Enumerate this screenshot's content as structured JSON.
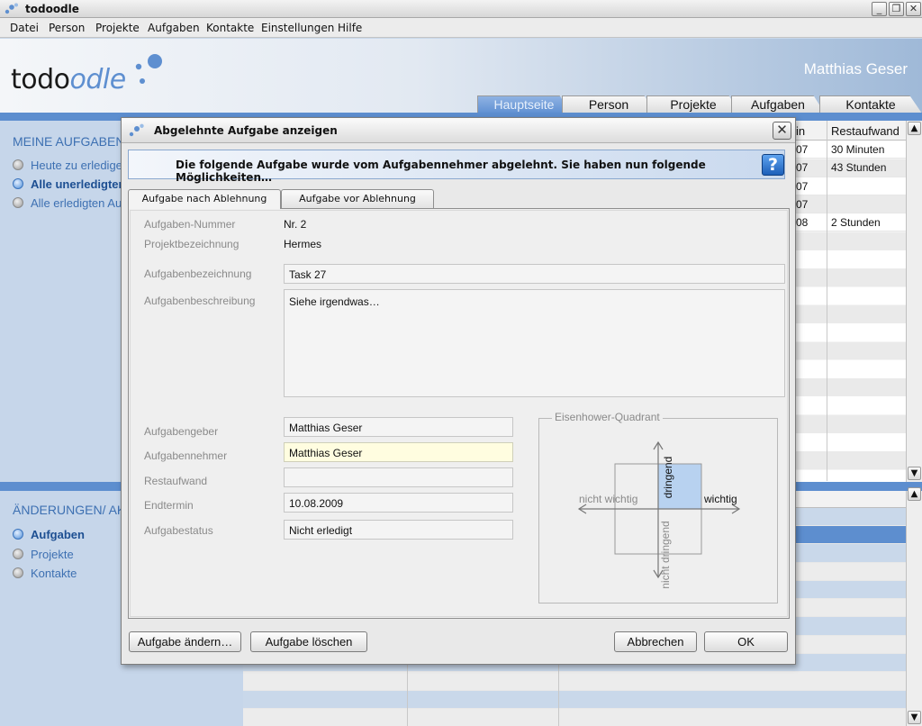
{
  "window": {
    "title": "todoodle"
  },
  "menu": {
    "items": [
      {
        "label": "Datei"
      },
      {
        "label": "Person"
      },
      {
        "label": "Projekte"
      },
      {
        "label": "Aufgaben"
      },
      {
        "label": "Kontakte"
      },
      {
        "label": "Einstellungen"
      },
      {
        "label": "Hilfe"
      }
    ]
  },
  "header": {
    "logo_part1": "todo",
    "logo_part2": "odle",
    "user_name": "Matthias Geser",
    "tabs": [
      {
        "label": "Hauptseite",
        "active": true
      },
      {
        "label": "Person"
      },
      {
        "label": "Projekte"
      },
      {
        "label": "Aufgaben"
      },
      {
        "label": "Kontakte"
      }
    ]
  },
  "sidebar": {
    "section1_title": "MEINE AUFGABEN",
    "section1_items": [
      {
        "label": "Heute zu erledigende Aufgaben"
      },
      {
        "label": "Alle unerledigten Aufgaben",
        "active": true
      },
      {
        "label": "Alle erledigten Aufgaben"
      }
    ],
    "section2_title": "ÄNDERUNGEN/ AKTIVITÄTEN",
    "section2_items": [
      {
        "label": "Aufgaben",
        "active": true
      },
      {
        "label": "Projekte"
      },
      {
        "label": "Kontakte"
      }
    ]
  },
  "bg_table": {
    "header_col1": "in",
    "header_col2": "Restaufwand",
    "rows": [
      {
        "c1": "07",
        "c2": "30 Minuten"
      },
      {
        "c1": "07",
        "c2": "43 Stunden"
      },
      {
        "c1": "07",
        "c2": ""
      },
      {
        "c1": "07",
        "c2": ""
      },
      {
        "c1": "08",
        "c2": "2 Stunden"
      }
    ]
  },
  "dialog": {
    "title": "Abgelehnte Aufgabe anzeigen",
    "info_message": "Die folgende Aufgabe wurde vom Aufgabennehmer abgelehnt. Sie haben nun folgende Möglichkeiten…",
    "tabs": [
      {
        "label": "Aufgabe nach Ablehnung",
        "active": true
      },
      {
        "label": "Aufgabe vor Ablehnung"
      }
    ],
    "fields": {
      "number_label": "Aufgaben-Nummer",
      "number_value": "Nr. 2",
      "project_label": "Projektbezeichnung",
      "project_value": "Hermes",
      "name_label": "Aufgabenbezeichnung",
      "name_value": "Task 27",
      "description_label": "Aufgabenbeschreibung",
      "description_value": "Siehe irgendwas…",
      "giver_label": "Aufgabengeber",
      "giver_value": "Matthias Geser",
      "taker_label": "Aufgabennehmer",
      "taker_value": "Matthias Geser",
      "effort_label": "Restaufwand",
      "effort_value": "",
      "deadline_label": "Endtermin",
      "deadline_value": "10.08.2009",
      "status_label": "Aufgabestatus",
      "status_value": "Nicht erledigt"
    },
    "quadrant": {
      "legend": "Eisenhower-Quadrant",
      "urgent": "dringend",
      "not_urgent": "nicht dringend",
      "important": "wichtig",
      "not_important": "nicht wichtig",
      "selected_quadrant": "dringend-wichtig",
      "highlight_color": "#b8d2f0"
    },
    "buttons": {
      "edit": "Aufgabe ändern…",
      "delete": "Aufgabe löschen",
      "cancel": "Abbrechen",
      "ok": "OK"
    },
    "help_glyph": "?"
  },
  "colors": {
    "accent": "#5d8ecf",
    "sidebar_text": "#3d70b2"
  }
}
